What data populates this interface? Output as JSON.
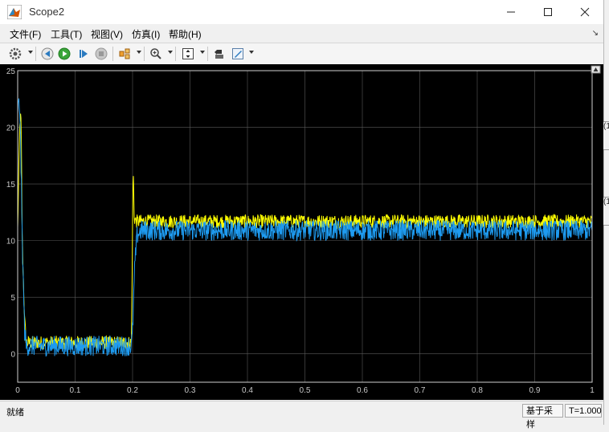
{
  "window": {
    "title": "Scope2"
  },
  "menu": [
    {
      "label": "文件(F)"
    },
    {
      "label": "工具(T)"
    },
    {
      "label": "视图(V)"
    },
    {
      "label": "仿真(I)"
    },
    {
      "label": "帮助(H)"
    }
  ],
  "toolbar": {
    "icons": [
      "gear-icon",
      "rewind-icon",
      "run-icon",
      "step-forward-icon",
      "stop-icon",
      "highlight-icon",
      "zoom-in-icon",
      "autoscale-icon",
      "restore-layout-icon",
      "properties-icon"
    ]
  },
  "status": {
    "state": "就绪",
    "mode": "基于采样",
    "time": "T=1.000"
  },
  "side_markers": [
    "(1",
    "(1"
  ],
  "colors": {
    "plot_bg": "#000000",
    "series_yellow": "#ffff00",
    "series_blue": "#1e9bf0",
    "grid": "#5a5a5a"
  },
  "chart_data": {
    "type": "line",
    "title": "",
    "xlabel": "",
    "ylabel": "",
    "xlim": [
      0,
      1
    ],
    "ylim": [
      -2.5,
      25
    ],
    "xticks": [
      "0",
      "0.1",
      "0.2",
      "0.3",
      "0.4",
      "0.5",
      "0.6",
      "0.7",
      "0.8",
      "0.9",
      "1"
    ],
    "yticks": [
      "0",
      "5",
      "10",
      "15",
      "20",
      "25"
    ],
    "grid": true,
    "series": [
      {
        "color": "#ffff00",
        "noise": 0.6,
        "x": [
          0,
          0.004,
          0.006,
          0.008,
          0.012,
          0.015,
          0.05,
          0.1,
          0.15,
          0.198,
          0.2,
          0.201,
          0.203,
          0.206,
          0.25,
          0.5,
          0.75,
          1.0
        ],
        "y": [
          11,
          21,
          20.5,
          10,
          3,
          1.0,
          1.0,
          1.0,
          1.0,
          1.0,
          11.5,
          16.5,
          12,
          11.7,
          11.7,
          11.7,
          11.7,
          11.7
        ]
      },
      {
        "color": "#1e9bf0",
        "noise": 0.9,
        "x": [
          0,
          0.002,
          0.004,
          0.008,
          0.012,
          0.015,
          0.05,
          0.1,
          0.15,
          0.198,
          0.2,
          0.204,
          0.208,
          0.215,
          0.25,
          0.5,
          0.75,
          1.0
        ],
        "y": [
          21.5,
          22,
          21.5,
          10,
          2,
          0.7,
          0.7,
          0.7,
          0.7,
          0.7,
          2,
          8,
          10.5,
          10.9,
          10.9,
          10.9,
          10.9,
          10.9
        ]
      }
    ]
  }
}
